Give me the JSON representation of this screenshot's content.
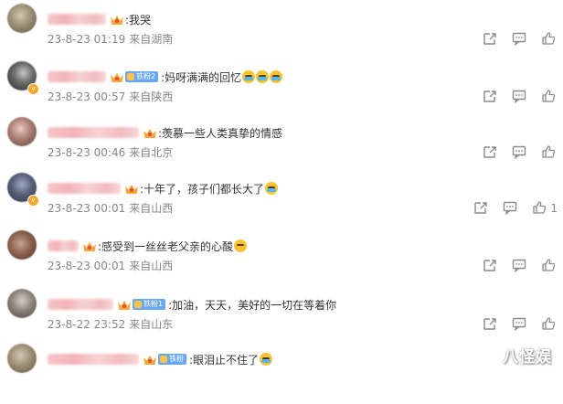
{
  "comments": [
    {
      "avatar": "v1",
      "verified": false,
      "name_width": 64,
      "badge": null,
      "text": ":我哭",
      "emojis": [],
      "date": "23-8-23 01:19",
      "location": "来自湖南",
      "like_count": ""
    },
    {
      "avatar": "v2",
      "verified": true,
      "name_width": 64,
      "badge": "铁粉2",
      "text": ":妈呀满满的回忆",
      "emojis": [
        "cry",
        "cry",
        "cry"
      ],
      "date": "23-8-23 00:57",
      "location": "来自陕西",
      "like_count": ""
    },
    {
      "avatar": "v3",
      "verified": false,
      "name_width": 100,
      "badge": null,
      "text": ":羡慕一些人类真挚的情感",
      "emojis": [],
      "date": "23-8-23 00:46",
      "location": "来自北京",
      "like_count": ""
    },
    {
      "avatar": "v4",
      "verified": true,
      "name_width": 80,
      "badge": null,
      "text": ":十年了，孩子们都长大了",
      "emojis": [
        "cry"
      ],
      "date": "23-8-23 00:01",
      "location": "来自山西",
      "like_count": "1"
    },
    {
      "avatar": "v5",
      "verified": false,
      "name_width": 34,
      "badge": null,
      "text": ":感受到一丝丝老父亲的心酸",
      "emojis": [
        "sad"
      ],
      "date": "23-8-23 00:01",
      "location": "来自山西",
      "like_count": ""
    },
    {
      "avatar": "v6",
      "verified": false,
      "name_width": 72,
      "badge": "铁粉1",
      "text": ":加油，天天，美好的一切在等着你",
      "emojis": [],
      "date": "23-8-22 23:52",
      "location": "来自山东",
      "like_count": ""
    },
    {
      "avatar": "v1",
      "verified": false,
      "name_width": 100,
      "badge": "铁粉",
      "text": ":眼泪止不住了",
      "emojis": [
        "cry"
      ],
      "date": "",
      "location": "",
      "like_count": ""
    }
  ],
  "watermark": "八怪娱",
  "icons": {
    "share": "share-icon",
    "comment": "comment-icon",
    "like": "like-icon"
  }
}
